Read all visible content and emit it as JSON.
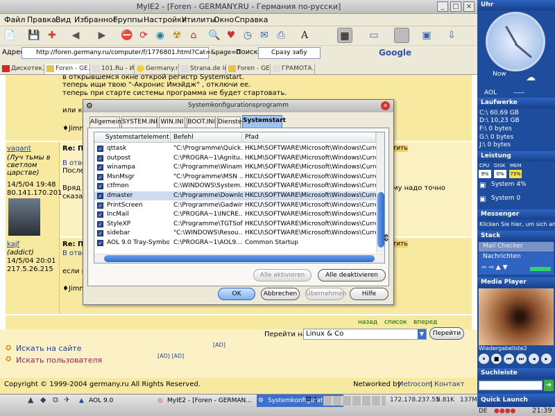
{
  "browser": {
    "title": "MyIE2 - [Foren - GERMANY.RU - Германия по-русски]",
    "menu": [
      "Файл",
      "Правка",
      "Вид",
      "Избранное",
      "Группы",
      "Настройки",
      "Утилиты",
      "Окно",
      "Справка"
    ],
    "address_label": "Адрес",
    "address_value": "http://foren.germany.ru/computer/f/1776801.html?Cat=&page=0",
    "search_label": "Поиск",
    "search_value": "Сразу забу",
    "google_label": "Google",
    "tabs": [
      "Дискотек...",
      "Foren - GE...",
      "101.Ru - Инте...",
      "Germany.ru",
      "Strana.de Ima...",
      "Foren - GE...",
      "ГРАМОТА.РУ..."
    ]
  },
  "forum": {
    "line1": "в открывшемся окне открой регистр Systemstart.",
    "line2": "теперь ищи твою \"-Акронис Имэйдж\" , отключи ее.",
    "line3": "теперь при старте системы программа не будет стартовать.",
    "line4": "или ко",
    "line5": "♦Jimm",
    "post1_user": "vagant",
    "post1_status": "(Луч тьмы в светлом царстве)",
    "post1_date": "14/5/04 19:48",
    "post1_ip": "80.141.170.201",
    "post1_re": "Re: П",
    "post1_reply": "В отве",
    "post1_next": "Послед",
    "post1_body_a": "Вряд л",
    "post1_body_b": "сказат",
    "post1_body_right": "му надо точно",
    "post2_user": "kajf",
    "post2_status": "(addict)",
    "post2_date": "14/5/04 20:01",
    "post2_ip": "217.5.26.215",
    "post2_re": "Re: П",
    "post2_reply": "В отве",
    "post2_body": "если н",
    "post2_sig": "♦Jimm",
    "reply_link": "тить",
    "nav_back": "назад",
    "nav_list": "список",
    "nav_fwd": "вперед",
    "goto_label": "Перейти на",
    "goto_value": "Linux & Co",
    "goto_button": "Перейти",
    "search_site": "Искать на сайте",
    "search_user": "Искать пользователя",
    "ad1": "[AD]",
    "ad2": "[AD] [AD]",
    "copyright": "Copyright © 1999-2004 germany.ru All Rights Reserved.",
    "networked": "Networked by",
    "metrocom": "Metrocom",
    "sep": "|",
    "contact": "Контакт"
  },
  "dialog": {
    "title": "Systemkonfigurationsprogramm",
    "tabs": [
      "Allgemein",
      "SYSTEM.INI",
      "WIN.INI",
      "BOOT.INI",
      "Dienste",
      "Systemstart"
    ],
    "columns": [
      "Systemstartelement",
      "Befehl",
      "Pfad"
    ],
    "rows": [
      {
        "name": "qttask",
        "cmd": "\"C:\\Programme\\Quick...",
        "path": "HKLM\\SOFTWARE\\Microsoft\\Windows\\CurrentVer...",
        "sel": false
      },
      {
        "name": "outpost",
        "cmd": "C:\\PROGRA~1\\Agnitu...",
        "path": "HKLM\\SOFTWARE\\Microsoft\\Windows\\CurrentVer...",
        "sel": false
      },
      {
        "name": "winampa",
        "cmd": "C:\\Programme\\Winam...",
        "path": "HKLM\\SOFTWARE\\Microsoft\\Windows\\CurrentVer...",
        "sel": false
      },
      {
        "name": "MsnMsgr",
        "cmd": "\"C:\\Programme\\MSN ...",
        "path": "HKCU\\SOFTWARE\\Microsoft\\Windows\\CurrentVer...",
        "sel": false
      },
      {
        "name": "ctfmon",
        "cmd": "C:\\WINDOWS\\System...",
        "path": "HKCU\\SOFTWARE\\Microsoft\\Windows\\CurrentVer...",
        "sel": false
      },
      {
        "name": "dmaster",
        "cmd": "C:\\Programme\\Downlo...",
        "path": "HKCU\\SOFTWARE\\Microsoft\\Windows\\CurrentVer...",
        "sel": true
      },
      {
        "name": "PrintScreen",
        "cmd": "C:\\Programme\\Gadwin...",
        "path": "HKCU\\SOFTWARE\\Microsoft\\Windows\\CurrentVer...",
        "sel": false
      },
      {
        "name": "IncMail",
        "cmd": "C:\\PROGRA~1\\INCRE...",
        "path": "HKCU\\SOFTWARE\\Microsoft\\Windows\\CurrentVer...",
        "sel": false
      },
      {
        "name": "StyleXP",
        "cmd": "C:\\Programme\\TGTSof...",
        "path": "HKCU\\SOFTWARE\\Microsoft\\Windows\\CurrentVer...",
        "sel": false
      },
      {
        "name": "sidebar",
        "cmd": "\"C:\\WINDOWS\\Resou...",
        "path": "HKCU\\SOFTWARE\\Microsoft\\Windows\\CurrentVer...",
        "sel": false
      },
      {
        "name": "AOL 9.0 Tray-Symbol",
        "cmd": "C:\\PROGRA~1\\AOL9...",
        "path": "Common Startup",
        "sel": false
      }
    ],
    "btn_enable_all": "Alle aktivieren",
    "btn_disable_all": "Alle deaktivieren",
    "btn_ok": "OK",
    "btn_cancel": "Abbrechen",
    "btn_apply": "Übernehmen",
    "btn_help": "Hilfe"
  },
  "sidebar": {
    "uhr": "Uhr",
    "now": "Now",
    "aol": "AOL",
    "aol_val": "-----",
    "laufwerke": "Laufwerke",
    "drives": [
      "C:\\ 60,69 GB",
      "D:\\ 10,23 GB",
      "F:\\ 0 bytes",
      "G:\\ 0 bytes",
      "J:\\ 0 bytes"
    ],
    "leistung": "Leistung",
    "cpu": "CPU",
    "disk": "DISK",
    "mem": "MEM",
    "cpu_val": "9%",
    "disk_val": "0%",
    "mem_val": "73%",
    "system1": "System 4%",
    "system2": "System 0",
    "messenger": "Messenger",
    "messenger_text": "Klicken Sie hier, um sich anz",
    "stack": "Stack",
    "mail_checker": "Mail Checker",
    "nachrichten": "Nachrichten",
    "media_player": "Media Player",
    "media_file": "Wiedergabeliste2",
    "suchleiste": "Suchleiste",
    "quick_launch": "Quick Launch"
  },
  "taskbar": {
    "aol": "AOL 9.0",
    "myie": "MyIE2 - [Foren - GERMAN...",
    "syscfg": "Systemkonfigurationsp...",
    "count": "1",
    "ip": "172.178.237.55",
    "rate": "8.81K",
    "mem": "137M",
    "lang": "DE",
    "clock": "21:39"
  },
  "colors": {
    "forum_bg": "#f8e9a0",
    "side_bg": "#1f4d9e",
    "accent": "#1c3fa0"
  }
}
